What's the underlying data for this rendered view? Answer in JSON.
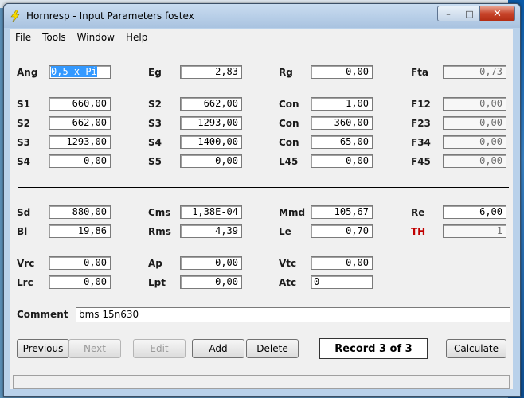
{
  "window": {
    "title": "Hornresp - Input Parameters   fostex"
  },
  "menu": [
    "File",
    "Tools",
    "Window",
    "Help"
  ],
  "row1": [
    {
      "label": "Ang",
      "value": "0,5 x Pi"
    },
    {
      "label": "Eg",
      "value": "2,83"
    },
    {
      "label": "Rg",
      "value": "0,00"
    },
    {
      "label": "Fta",
      "value": "0,73"
    }
  ],
  "horn_rows": [
    [
      {
        "label": "S1",
        "value": "660,00"
      },
      {
        "label": "S2",
        "value": "662,00"
      },
      {
        "label": "Con",
        "value": "1,00"
      },
      {
        "label": "F12",
        "value": "0,00"
      }
    ],
    [
      {
        "label": "S2",
        "value": "662,00"
      },
      {
        "label": "S3",
        "value": "1293,00"
      },
      {
        "label": "Con",
        "value": "360,00"
      },
      {
        "label": "F23",
        "value": "0,00"
      }
    ],
    [
      {
        "label": "S3",
        "value": "1293,00"
      },
      {
        "label": "S4",
        "value": "1400,00"
      },
      {
        "label": "Con",
        "value": "65,00"
      },
      {
        "label": "F34",
        "value": "0,00"
      }
    ],
    [
      {
        "label": "S4",
        "value": "0,00"
      },
      {
        "label": "S5",
        "value": "0,00"
      },
      {
        "label": "L45",
        "value": "0,00"
      },
      {
        "label": "F45",
        "value": "0,00"
      }
    ]
  ],
  "driver_rows": [
    [
      {
        "label": "Sd",
        "value": "880,00"
      },
      {
        "label": "Cms",
        "value": "1,38E-04"
      },
      {
        "label": "Mmd",
        "value": "105,67"
      },
      {
        "label": "Re",
        "value": "6,00"
      }
    ],
    [
      {
        "label": "Bl",
        "value": "19,86"
      },
      {
        "label": "Rms",
        "value": "4,39"
      },
      {
        "label": "Le",
        "value": "0,70"
      },
      {
        "label": "TH",
        "value": "1"
      }
    ]
  ],
  "chamber_rows": [
    [
      {
        "label": "Vrc",
        "value": "0,00"
      },
      {
        "label": "Ap",
        "value": "0,00"
      },
      {
        "label": "Vtc",
        "value": "0,00"
      }
    ],
    [
      {
        "label": "Lrc",
        "value": "0,00"
      },
      {
        "label": "Lpt",
        "value": "0,00"
      },
      {
        "label": "Atc",
        "value": "0"
      }
    ]
  ],
  "comment": {
    "label": "Comment",
    "value": "bms 15n630"
  },
  "buttons": {
    "previous": "Previous",
    "next": "Next",
    "edit": "Edit",
    "add": "Add",
    "delete": "Delete",
    "calculate": "Calculate"
  },
  "record": "Record 3 of 3",
  "colors": {
    "accent_red": "#c00000",
    "selection": "#3399ff"
  }
}
